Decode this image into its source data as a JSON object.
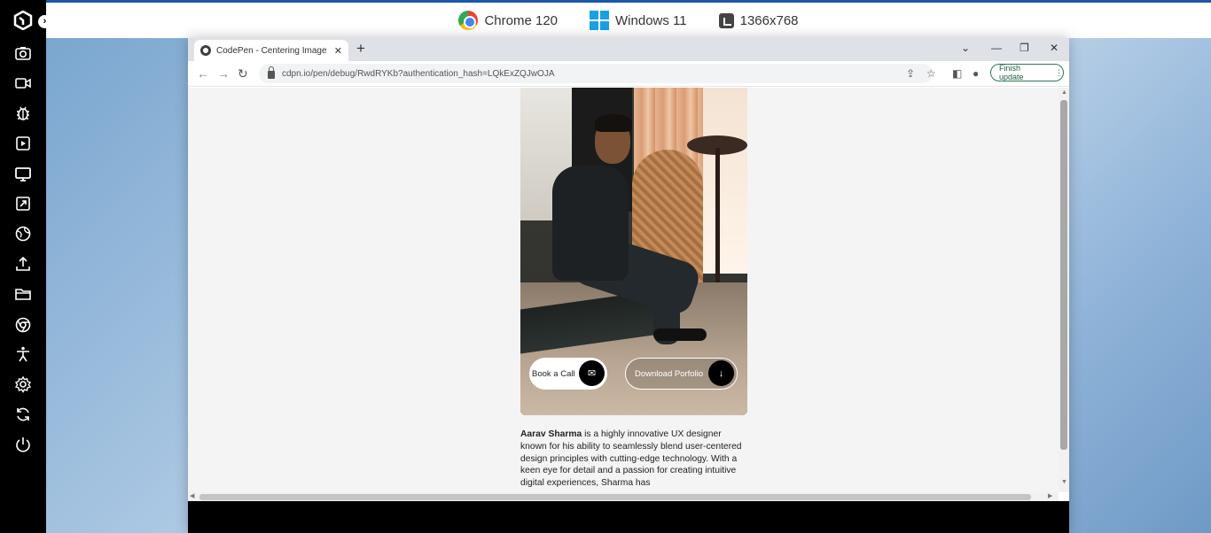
{
  "topbar": {
    "browser": "Chrome 120",
    "os": "Windows 11",
    "resolution": "1366x768"
  },
  "sidebar": {
    "items": [
      "camera-icon",
      "video-icon",
      "bug-icon",
      "playback-icon",
      "monitor-icon",
      "resize-icon",
      "globe-icon",
      "upload-icon",
      "folder-icon",
      "chrome-icon",
      "accessibility-icon",
      "settings-icon",
      "switch-icon",
      "power-icon"
    ]
  },
  "browser": {
    "tab_title": "CodePen - Centering Image in C",
    "url": "cdpn.io/pen/debug/RwdRYKb?authentication_hash=LQkExZQJwOJA",
    "update_button": "Finish update"
  },
  "page": {
    "buttons": {
      "call": "Book a Call",
      "download": "Download Porfolio"
    },
    "bio": {
      "name": "Aarav Sharma",
      "text": " is a highly innovative UX designer known for his ability to seamlessly blend user-centered design principles with cutting-edge technology. With a keen eye for detail and a passion for creating intuitive digital experiences, Sharma has"
    }
  },
  "colors": {
    "sidebar": "#000000",
    "accent": "#1e57a8",
    "update_green": "#2a7a52"
  }
}
